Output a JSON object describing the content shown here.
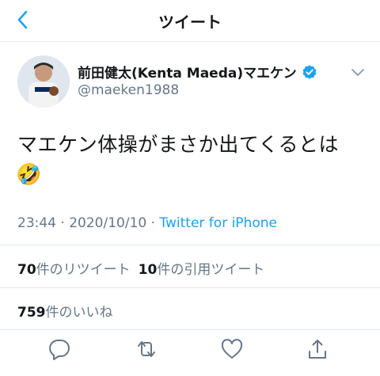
{
  "header": {
    "title": "ツイート",
    "back_icon": "chevron-left-icon"
  },
  "author": {
    "display_name": "前田健太(Kenta Maeda)マエケン",
    "handle": "@maeken1988",
    "verified_icon": "verified-badge-icon",
    "menu_icon": "chevron-down-icon"
  },
  "tweet": {
    "text": "マエケン体操がまさか出てくるとは",
    "emoji": "🤣",
    "time": "23:44",
    "date": "2020/10/10",
    "separator": "·",
    "source": "Twitter for iPhone"
  },
  "stats": {
    "retweets_count": "70",
    "retweets_label": "件のリツイート",
    "quotes_count": "10",
    "quotes_label": "件の引用ツイート",
    "likes_count": "759",
    "likes_label": "件のいいね"
  },
  "actions": [
    {
      "name": "reply",
      "icon": "reply-icon"
    },
    {
      "name": "retweet",
      "icon": "retweet-icon"
    },
    {
      "name": "like",
      "icon": "heart-icon"
    },
    {
      "name": "share",
      "icon": "share-icon"
    }
  ],
  "colors": {
    "accent": "#1da1f2",
    "muted": "#657786",
    "text": "#14171a",
    "divider": "#e1e8ed"
  }
}
